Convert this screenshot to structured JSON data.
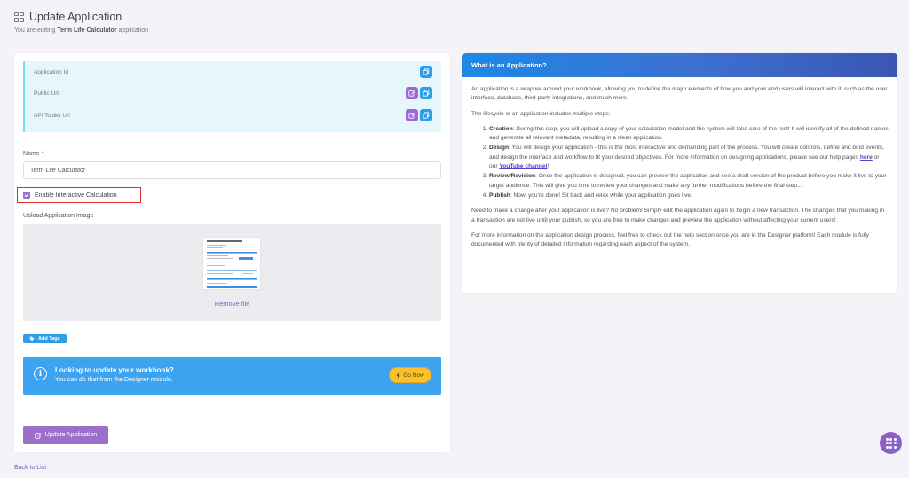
{
  "header": {
    "title": "Update Application",
    "subtitle_prefix": "You are editing",
    "app_name": "Term Life Calculator",
    "subtitle_suffix": "application"
  },
  "info": {
    "application_id_label": "Application Id",
    "public_url_label": "Public Url",
    "api_toolkit_url_label": "API Toolkit Url"
  },
  "form": {
    "name_label": "Name",
    "required_mark": "*",
    "name_value": "Term Life Calculator",
    "enable_interactive_label": "Enable Interactive Calculation",
    "enable_interactive_checked": true,
    "upload_label": "Upload Application Image",
    "remove_file_label": "Remove file",
    "add_tags_label": "Add Tags",
    "update_button_label": "Update Application"
  },
  "alert": {
    "title": "Looking to update your workbook?",
    "text": "You can do that from the Designer module.",
    "go_label": "Go Now"
  },
  "back_link": "Back to List",
  "help": {
    "title": "What is an Application?",
    "intro": "An application is a wrapper around your workbook, allowing you to define the major elements of how you and your end users will interact with it, such as the user interface, database, third-party integrations, and much more.",
    "lifecycle_intro": "The lifecycle of an application includes multiple steps:",
    "steps": [
      {
        "name": "Creation",
        "text": ": During this step, you will upload a copy of your calculation model and the system will take care of the rest! It will identify all of the defined names and generate all relevant metadata, resulting in a clean application."
      },
      {
        "name": "Design",
        "text": ": You will design your application - this is the most interactive and demanding part of the process. You will create controls, define and bind events, and design the interface and workflow to fit your desired objectives. For more information on designing applications, please see our help pages "
      },
      {
        "name": "Review/Revision",
        "text": ": Once the application is designed, you can preview the application and see a draft version of the product before you make it live to your target audience. This will give you time to review your changes and make any further modifications before the final step..."
      },
      {
        "name": "Publish",
        "text": ": Now, you're done! Sit back and relax while your application goes live."
      }
    ],
    "design_link_here": "here",
    "design_link_or": " or our ",
    "design_link_youtube": "YouTube channel",
    "design_link_end": "!",
    "change_part1": "Need to make a change after your application is live? No problem! Simply edit the application again to begin ",
    "change_italic": "a new transaction",
    "change_part2": ". The changes that you making in a transaction are not live until your publish, so you are free to make changes and preview the application without affecting your current users!",
    "more_info": "For more information on the application design process, feel free to check out the help section once you are in the Designer platform! Each module is fully documented with plenty of detailed information regarding each aspect of the system."
  },
  "icons": {
    "page": "grid-icon",
    "copy": "copy-icon",
    "edit": "edit-icon",
    "tag": "tag-icon",
    "info": "info-icon",
    "bolt": "bolt-icon",
    "update": "edit-icon",
    "apps": "apps-grid-icon"
  },
  "colors": {
    "accent_purple": "#9b6fc9",
    "accent_blue": "#2d9ee7",
    "alert_blue": "#3ba3f0",
    "go_yellow": "#fbc02d",
    "highlight_red": "#e0282d"
  }
}
